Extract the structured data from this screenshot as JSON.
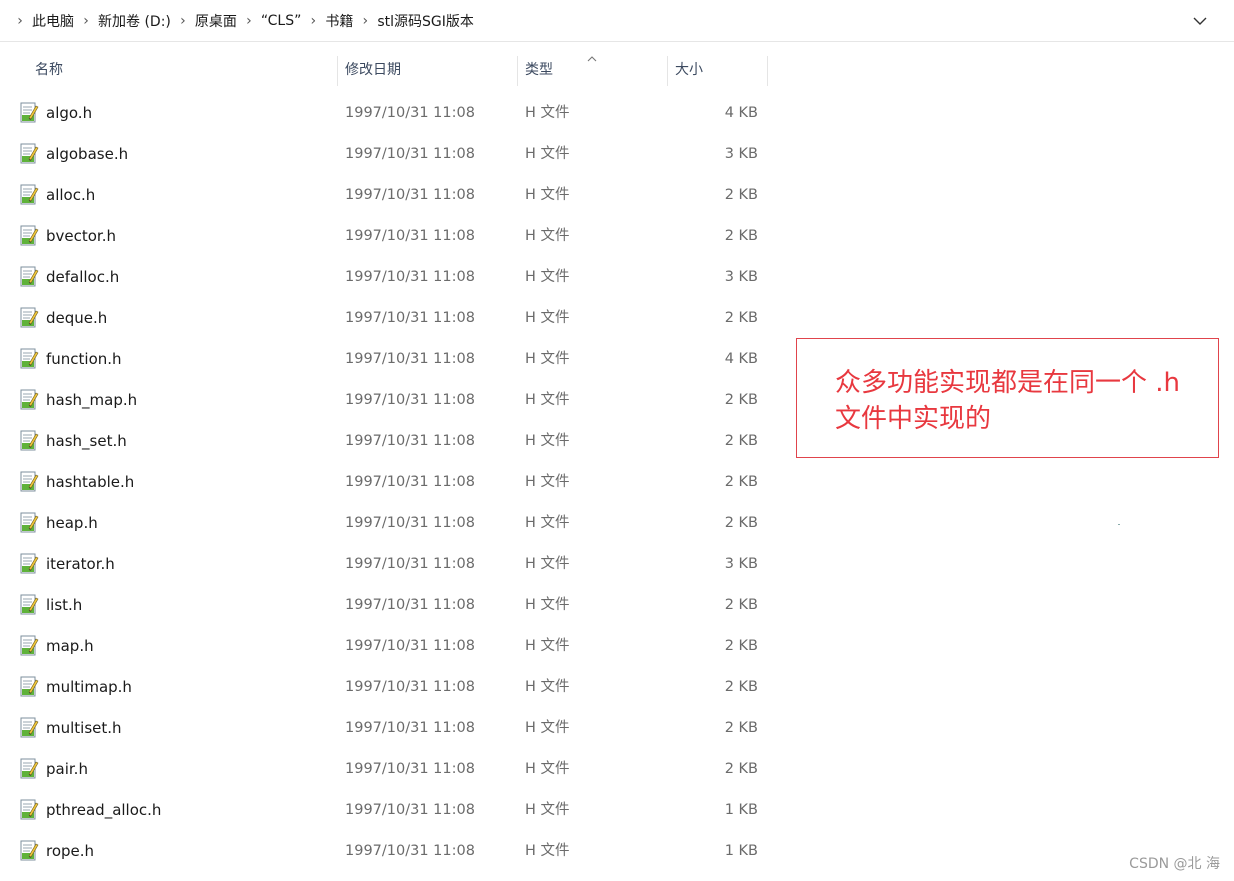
{
  "breadcrumb": [
    "此电脑",
    "新加卷 (D:)",
    "原桌面",
    "“CLS”",
    "书籍",
    "stl源码SGI版本"
  ],
  "columns": {
    "name": "名称",
    "date": "修改日期",
    "type": "类型",
    "size": "大小"
  },
  "files": [
    {
      "name": "algo.h",
      "date": "1997/10/31 11:08",
      "type": "H 文件",
      "size": "4 KB"
    },
    {
      "name": "algobase.h",
      "date": "1997/10/31 11:08",
      "type": "H 文件",
      "size": "3 KB"
    },
    {
      "name": "alloc.h",
      "date": "1997/10/31 11:08",
      "type": "H 文件",
      "size": "2 KB"
    },
    {
      "name": "bvector.h",
      "date": "1997/10/31 11:08",
      "type": "H 文件",
      "size": "2 KB"
    },
    {
      "name": "defalloc.h",
      "date": "1997/10/31 11:08",
      "type": "H 文件",
      "size": "3 KB"
    },
    {
      "name": "deque.h",
      "date": "1997/10/31 11:08",
      "type": "H 文件",
      "size": "2 KB"
    },
    {
      "name": "function.h",
      "date": "1997/10/31 11:08",
      "type": "H 文件",
      "size": "4 KB"
    },
    {
      "name": "hash_map.h",
      "date": "1997/10/31 11:08",
      "type": "H 文件",
      "size": "2 KB"
    },
    {
      "name": "hash_set.h",
      "date": "1997/10/31 11:08",
      "type": "H 文件",
      "size": "2 KB"
    },
    {
      "name": "hashtable.h",
      "date": "1997/10/31 11:08",
      "type": "H 文件",
      "size": "2 KB"
    },
    {
      "name": "heap.h",
      "date": "1997/10/31 11:08",
      "type": "H 文件",
      "size": "2 KB"
    },
    {
      "name": "iterator.h",
      "date": "1997/10/31 11:08",
      "type": "H 文件",
      "size": "3 KB"
    },
    {
      "name": "list.h",
      "date": "1997/10/31 11:08",
      "type": "H 文件",
      "size": "2 KB"
    },
    {
      "name": "map.h",
      "date": "1997/10/31 11:08",
      "type": "H 文件",
      "size": "2 KB"
    },
    {
      "name": "multimap.h",
      "date": "1997/10/31 11:08",
      "type": "H 文件",
      "size": "2 KB"
    },
    {
      "name": "multiset.h",
      "date": "1997/10/31 11:08",
      "type": "H 文件",
      "size": "2 KB"
    },
    {
      "name": "pair.h",
      "date": "1997/10/31 11:08",
      "type": "H 文件",
      "size": "2 KB"
    },
    {
      "name": "pthread_alloc.h",
      "date": "1997/10/31 11:08",
      "type": "H 文件",
      "size": "1 KB"
    },
    {
      "name": "rope.h",
      "date": "1997/10/31 11:08",
      "type": "H 文件",
      "size": "1 KB"
    }
  ],
  "annotation": {
    "line1": "众多功能实现都是在同一个 .h",
    "line2": "文件中实现的",
    "color": "#e8383f"
  },
  "watermark": "CSDN @北 海",
  "icons": {
    "file": "h-file-icon",
    "sort": "sort-ascending-icon",
    "dropdown": "chevron-down-icon",
    "separator": "chevron-right-icon"
  }
}
